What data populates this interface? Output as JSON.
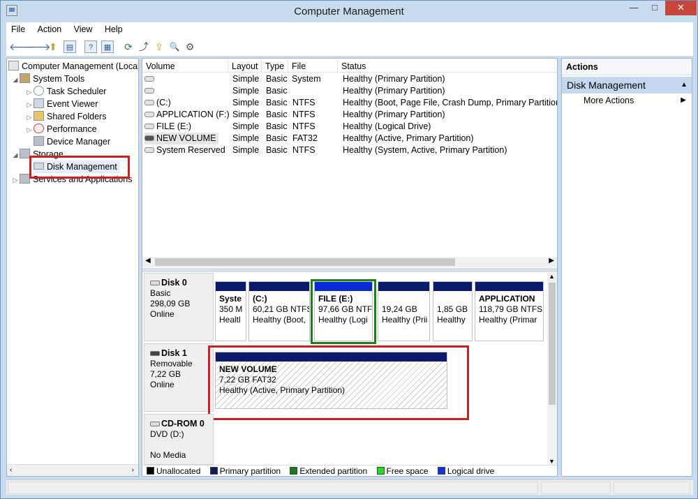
{
  "window": {
    "title": "Computer Management",
    "controls": {
      "min": "—",
      "max": "□",
      "close": "✕"
    }
  },
  "menu": [
    "File",
    "Action",
    "View",
    "Help"
  ],
  "toolbar": {
    "back": "🡐",
    "forward": "🡒",
    "up": "⬆",
    "show_tree": "▤",
    "help": "?",
    "props": "▦",
    "refresh": "⟳",
    "export": "⤴",
    "open": "⇪",
    "find": "🔍",
    "settings": "⚙"
  },
  "tree": {
    "root": "Computer Management (Local",
    "system_tools": "System Tools",
    "task_scheduler": "Task Scheduler",
    "event_viewer": "Event Viewer",
    "shared_folders": "Shared Folders",
    "performance": "Performance",
    "device_manager": "Device Manager",
    "storage": "Storage",
    "disk_management": "Disk Management",
    "services": "Services and Applications"
  },
  "volume_list": {
    "headers": [
      "Volume",
      "Layout",
      "Type",
      "File System",
      "Status"
    ],
    "rows": [
      {
        "volume": "",
        "layout": "Simple",
        "type": "Basic",
        "fs": "",
        "status": "Healthy (Primary Partition)"
      },
      {
        "volume": "",
        "layout": "Simple",
        "type": "Basic",
        "fs": "",
        "status": "Healthy (Primary Partition)"
      },
      {
        "volume": "(C:)",
        "layout": "Simple",
        "type": "Basic",
        "fs": "NTFS",
        "status": "Healthy (Boot, Page File, Crash Dump, Primary Partition)"
      },
      {
        "volume": "APPLICATION (F:)",
        "layout": "Simple",
        "type": "Basic",
        "fs": "NTFS",
        "status": "Healthy (Primary Partition)"
      },
      {
        "volume": "FILE (E:)",
        "layout": "Simple",
        "type": "Basic",
        "fs": "NTFS",
        "status": "Healthy (Logical Drive)"
      },
      {
        "volume": "NEW VOLUME",
        "layout": "Simple",
        "type": "Basic",
        "fs": "FAT32",
        "status": "Healthy (Active, Primary Partition)"
      },
      {
        "volume": "System Reserved",
        "layout": "Simple",
        "type": "Basic",
        "fs": "NTFS",
        "status": "Healthy (System, Active, Primary Partition)"
      }
    ]
  },
  "disks": {
    "disk0": {
      "name": "Disk 0",
      "kind": "Basic",
      "size": "298,09 GB",
      "state": "Online"
    },
    "disk1": {
      "name": "Disk 1",
      "kind": "Removable",
      "size": "7,22 GB",
      "state": "Online"
    },
    "cdrom": {
      "name": "CD-ROM 0",
      "kind": "DVD (D:)",
      "state": "No Media"
    }
  },
  "partitions": {
    "sysres": {
      "title": "Syste",
      "line1": "350 M",
      "line2": "Healtl"
    },
    "c": {
      "title": "(C:)",
      "line1": "60,21 GB NTFS",
      "line2": "Healthy (Boot,"
    },
    "file": {
      "title": "FILE  (E:)",
      "line1": "97,66 GB NTF",
      "line2": "Healthy (Logi"
    },
    "p4": {
      "title": "",
      "line1": "19,24 GB",
      "line2": "Healthy (Prii"
    },
    "p5": {
      "title": "",
      "line1": "1,85 GB",
      "line2": "Healthy"
    },
    "app": {
      "title": "APPLICATION",
      "line1": "118,79 GB NTFS",
      "line2": "Healthy (Primar"
    },
    "newvol": {
      "title": "NEW VOLUME",
      "line1": "7,22 GB FAT32",
      "line2": "Healthy (Active, Primary Partition)"
    }
  },
  "legend": {
    "items": [
      {
        "label": "Unallocated",
        "color": "#000000"
      },
      {
        "label": "Primary partition",
        "color": "#0b1a6b"
      },
      {
        "label": "Extended partition",
        "color": "#1a7a1a"
      },
      {
        "label": "Free space",
        "color": "#22dd22"
      },
      {
        "label": "Logical drive",
        "color": "#1030e8"
      }
    ]
  },
  "actions": {
    "header": "Actions",
    "section": "Disk Management",
    "more": "More Actions"
  },
  "colors": {
    "highlight_red": "#cc1f1f",
    "highlight_green": "#19801a",
    "primary_bar": "#0b1a6b",
    "logical_bar": "#0a2ad8"
  }
}
